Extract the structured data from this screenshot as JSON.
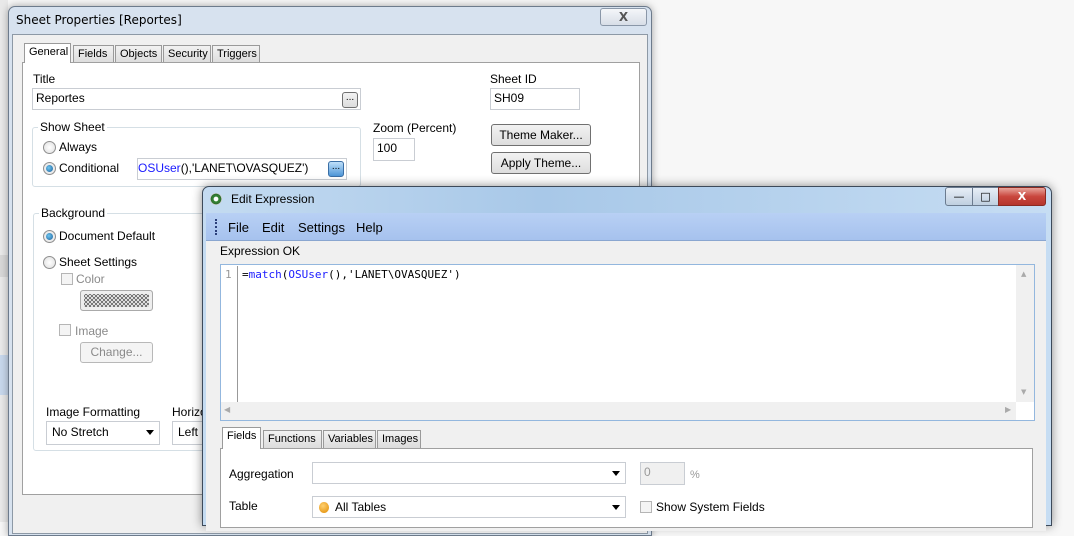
{
  "sheet_properties": {
    "title": "Sheet Properties [Reportes]",
    "close_label": "X",
    "tabs": [
      "General",
      "Fields",
      "Objects",
      "Security",
      "Triggers"
    ],
    "active_tab": "General",
    "title_label": "Title",
    "title_value": "Reportes",
    "ellipsis": "...",
    "sheet_id_label": "Sheet ID",
    "sheet_id_value": "SH09",
    "show_sheet": {
      "label": "Show Sheet",
      "always": "Always",
      "conditional": "Conditional",
      "selected": "Conditional",
      "condition_func": "OSUser",
      "condition_rest": "(),'LANET\\OVASQUEZ')"
    },
    "zoom_label": "Zoom (Percent)",
    "zoom_value": "100",
    "theme_maker": "Theme Maker...",
    "apply_theme": "Apply Theme...",
    "background": {
      "label": "Background",
      "document_default": "Document Default",
      "sheet_settings": "Sheet Settings",
      "selected": "Document Default",
      "color": "Color",
      "image": "Image",
      "change": "Change...",
      "image_formatting_label": "Image Formatting",
      "image_formatting_value": "No Stretch",
      "horizontal_label": "Horizo",
      "horizontal_value": "Left"
    }
  },
  "edit_expression": {
    "title": "Edit Expression",
    "menu": [
      "File",
      "Edit",
      "Settings",
      "Help"
    ],
    "status": "Expression OK",
    "line_number": "1",
    "code": {
      "eq": "=",
      "func": "match",
      "open": "(",
      "inner": "OSUser",
      "rest": "(),'LANET\\OVASQUEZ')"
    },
    "tabs": [
      "Fields",
      "Functions",
      "Variables",
      "Images"
    ],
    "active_tab": "Fields",
    "aggregation_label": "Aggregation",
    "aggregation_value": "",
    "percent_value": "0",
    "percent_sign": "%",
    "table_label": "Table",
    "table_value": "All Tables",
    "show_system_fields": "Show System Fields",
    "colors": {
      "keyword": "#1a1aff",
      "accent_orange": "#f0a020",
      "close_red": "#c9463d"
    }
  }
}
